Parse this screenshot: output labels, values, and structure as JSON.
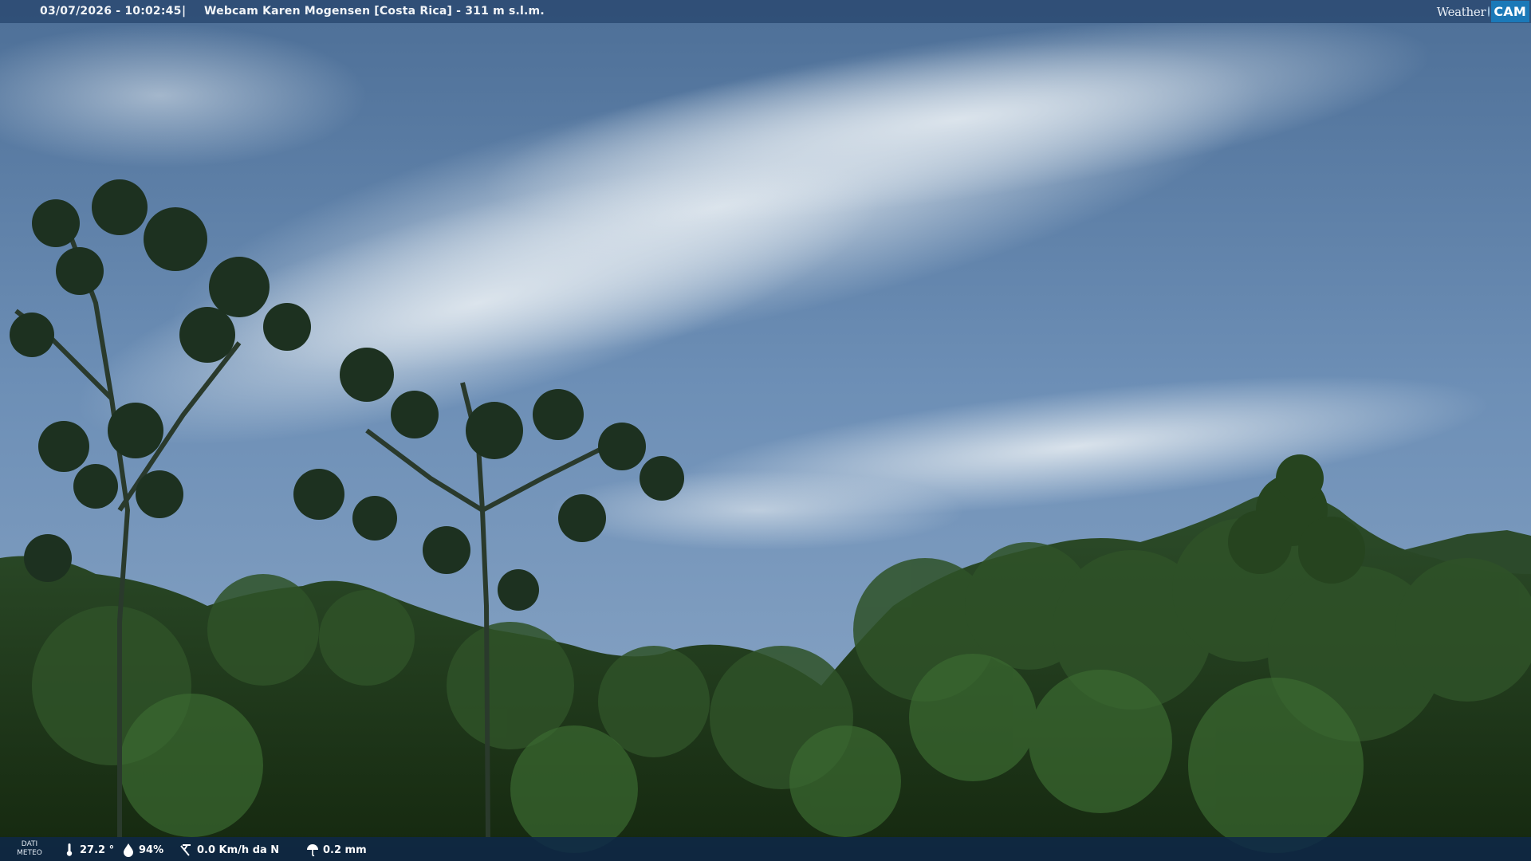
{
  "header": {
    "datetime": "03/07/2026 - 10:02:45",
    "separator": "|",
    "title": "Webcam Karen Mogensen [Costa Rica]  - 311 m s.l.m."
  },
  "brand": {
    "word": "Weather",
    "mark": "CAM"
  },
  "footer": {
    "label_line1": "DATI",
    "label_line2": "METEO",
    "temperature": "27.2 °",
    "humidity": "94%",
    "wind": "0.0 Km/h da N",
    "rain": "0.2 mm"
  },
  "icons": {
    "temperature": "thermometer-icon",
    "humidity": "humidity-drop-icon",
    "wind": "wind-icon",
    "rain": "rain-umbrella-icon"
  },
  "colors": {
    "sky": "#5c7da3",
    "clouds": "#c9d6e0",
    "forest": "#1f3a1c",
    "brand_accent": "#1b79b8"
  }
}
